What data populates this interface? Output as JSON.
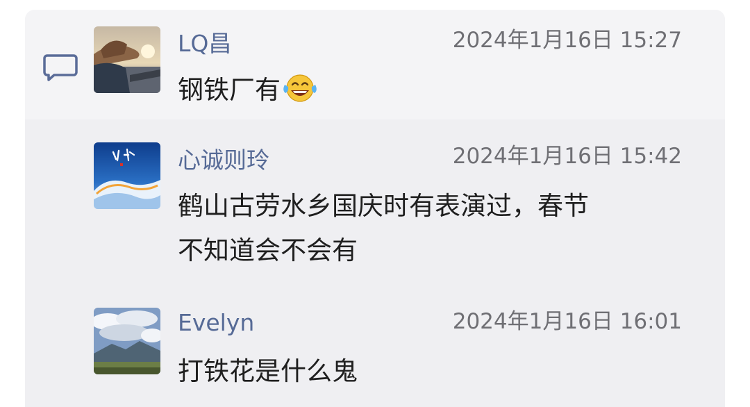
{
  "comments": [
    {
      "user": "LQ昌",
      "time": "2024年1月16日 15:27",
      "text": "钢铁厂有",
      "emoji": "laughing-tears-emoji",
      "avatar": "cowboy-hat-sunset-avatar"
    },
    {
      "user": "心诚则玲",
      "time": "2024年1月16日 15:42",
      "text": "鹤山古劳水乡国庆时有表演过，春节\n不知道会不会有",
      "avatar": "blue-wave-art-avatar"
    },
    {
      "user": "Evelyn",
      "time": "2024年1月16日 16:01",
      "text": "打铁花是什么鬼",
      "avatar": "cloudy-mountain-avatar"
    }
  ],
  "colors": {
    "username": "#566a96",
    "timestamp": "#6f6f74",
    "panel": "#f2f2f4",
    "icon": "#5a6c98"
  }
}
